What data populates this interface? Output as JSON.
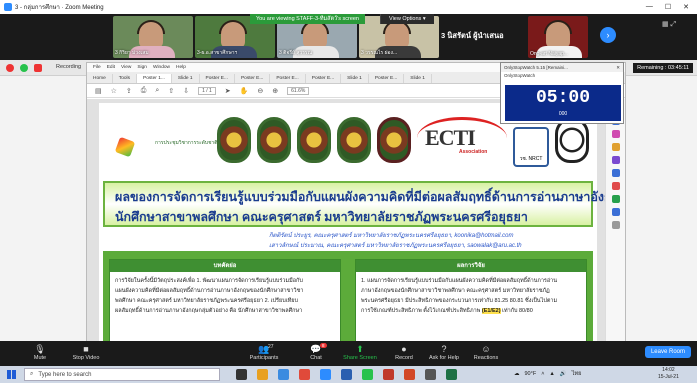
{
  "window": {
    "title": "3 - กลุ่มการศึกษา · Zoom Meeting",
    "controls": [
      "—",
      "☐",
      "✕"
    ]
  },
  "gallery": {
    "viewing_banner": "You are viewing STAFF-3-ทีมสัตว์'s screen",
    "view_options": "View Options ▾",
    "tiles": [
      {
        "name": "3 กิริยา ม่วงเสม"
      },
      {
        "name": "3-ผ.อ.สาขาศึกษาฯ"
      },
      {
        "name": "3 ติจรีย์ สุวรรณ"
      },
      {
        "name": "3 วรรณไร ผ่อง..."
      },
      {
        "name": "3 นิสรัตน์ ผู้นำเสนอ"
      },
      {
        "name": "Ong-art Naiyap..."
      }
    ],
    "next_icon": "chevron-right-icon"
  },
  "share": {
    "recording_label": "Recording",
    "remaining": "Remaining : 03:45:11"
  },
  "pdf": {
    "menu": [
      "File",
      "Edit",
      "View",
      "Sign",
      "Window",
      "Help"
    ],
    "tabs": [
      "Home",
      "Tools",
      "Poster 1...",
      "Slide 1",
      "Poster E...",
      "Poster E...",
      "Poster E...",
      "Poster E...",
      "Slide 1",
      "Poster E...",
      "Slide 1"
    ],
    "page_indicator": "1 / 1",
    "zoom": "61.6%"
  },
  "poster": {
    "left_logo_text": "การประชุมวิชาการระดับชาติ",
    "ecti_word": "ECTI",
    "ecti_sub": "Association",
    "nrct_label": "วช. NRCT",
    "title_line1": "ผลของการจัดการเรียนรู้แบบร่วมมือกับแผนผังความคิดที่มีต่อผลสัมฤทธิ์ด้านการอ่านภาษาอังกฤษของ",
    "title_line2": "นักศึกษาสาขาพลศึกษา คณะครุศาสตร์ มหาวิทยาลัยราชภัฏพระนครศรีอยุธยา",
    "author_line1": "กิตติรัตน์ ประยูร, คณะครุศาสตร์ มหาวิทยาลัยราชภัฏพระนครศรีอยุธยา, koonika@hotmail.com",
    "author_line2": "เสาวลักษณ์ ประมาณ, คณะครุศาสตร์ มหาวิทยาลัยราชภัฏพระนครศรีอยุธยา, saowalak@aru.ac.th",
    "abstract_head": "บทคัดย่อ",
    "abstract_lines": [
      "การวิจัยในครั้งนี้มีวัตถุประสงค์เพื่อ 1. พัฒนาแผนการจัดการเรียนรู้แบบร่วมมือกับ",
      "แผนผังความคิดที่มีต่อผลสัมฤทธิ์ด้านการอ่านภาษาอังกฤษของนักศึกษาสาขาวิชา",
      "พลศึกษา คณะครุศาสตร์ มหาวิทยาลัยราชภัฏพระนครศรีอยุธยา 2. เปรียบเทียบ",
      "ผลสัมฤทธิ์ด้านการอ่านภาษาอังกฤษกลุ่มตัวอย่าง คือ นักศึกษาสาขาวิชาพลศึกษา"
    ],
    "results_head": "ผลการวิจัย",
    "results_lines": [
      "1. แผนการจัดการเรียนรู้แบบร่วมมือกับแผนผังความคิดที่มีต่อผลสัมฤทธิ์ด้านการอ่าน",
      "ภาษาอังกฤษของนักศึกษาสาขาวิชาพลศึกษา คณะครุศาสตร์ มหาวิทยาลัยราชภัฏ",
      "พระนครศรีอยุธยา มีประสิทธิภาพของกระบวนการเท่ากับ 81.25 80.81 ซึ่งเป็นไปตาม",
      "การใช้เกณฑ์ประสิทธิภาพ ตั้งไว้เกณฑ์ประสิทธิภาพ (E1/E2) เท่ากับ 80/80"
    ],
    "results_highlight": "(E1/E2)"
  },
  "stopwatch": {
    "title": "OnlyStopWatch 5.15 [Remaini...",
    "subtitle": "OnlyStopWatch",
    "time": "05:00",
    "ms": "000"
  },
  "toolbar": {
    "mute": "Mute",
    "stop_video": "Stop Video",
    "participants": "Participants",
    "participants_count": "27",
    "chat": "Chat",
    "chat_badge": "8",
    "share_screen": "Share Screen",
    "record": "Record",
    "help": "Ask for Help",
    "reactions": "Reactions",
    "leave": "Leave Room"
  },
  "taskbar": {
    "search_placeholder": "Type here to search",
    "weather": "90°F",
    "time": "14:02",
    "date": "15-Jul-21",
    "lang": "ไทย"
  }
}
